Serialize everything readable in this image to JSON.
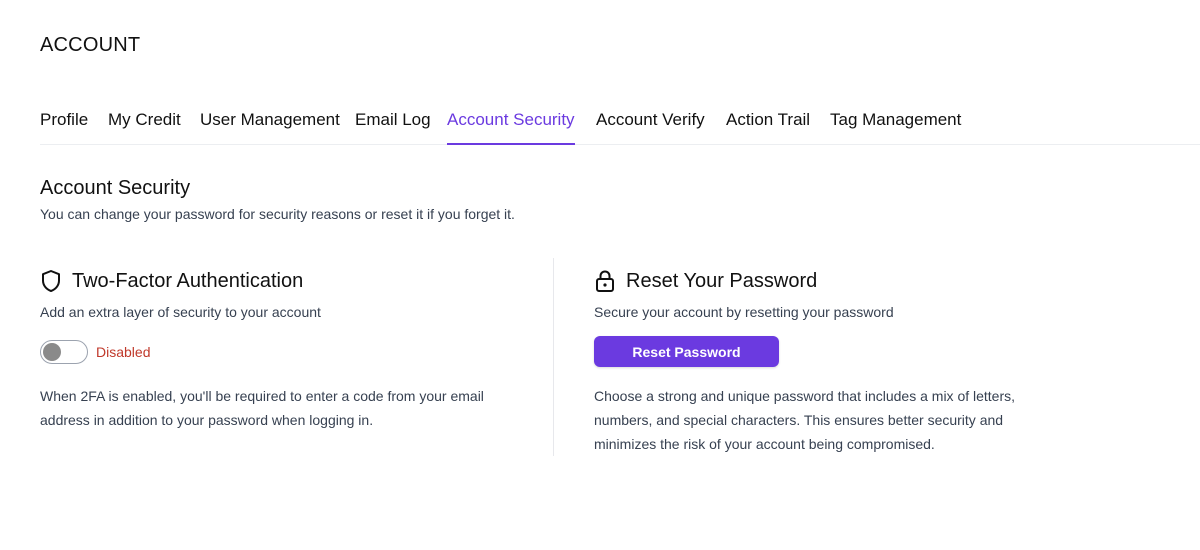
{
  "page": {
    "title": "ACCOUNT"
  },
  "tabs": [
    {
      "label": "Profile"
    },
    {
      "label": "My Credit"
    },
    {
      "label": "User Management"
    },
    {
      "label": "Email Log"
    },
    {
      "label": "Account Security",
      "active": true
    },
    {
      "label": "Account Verify"
    },
    {
      "label": "Action Trail"
    },
    {
      "label": "Tag Management"
    }
  ],
  "section": {
    "title": "Account Security",
    "subtitle": "You can change your password for security reasons or reset it if you forget it."
  },
  "two_factor": {
    "icon": "shield-icon",
    "title": "Two-Factor Authentication",
    "description": "Add an extra layer of security to your account",
    "toggle_on": false,
    "status": "Disabled",
    "status_color": "#c0392b",
    "help": "When 2FA is enabled, you'll be required to enter a code from your email address in addition to your password when logging in."
  },
  "reset_password": {
    "icon": "lock-icon",
    "title": "Reset Your Password",
    "description": "Secure your account by resetting your password",
    "button_label": "Reset Password",
    "help": "Choose a strong and unique password that includes a mix of letters, numbers, and special characters. This ensures better security and minimizes the risk of your account being compromised."
  },
  "colors": {
    "accent": "#6b3ae0",
    "text": "#111111",
    "muted": "#374151"
  }
}
